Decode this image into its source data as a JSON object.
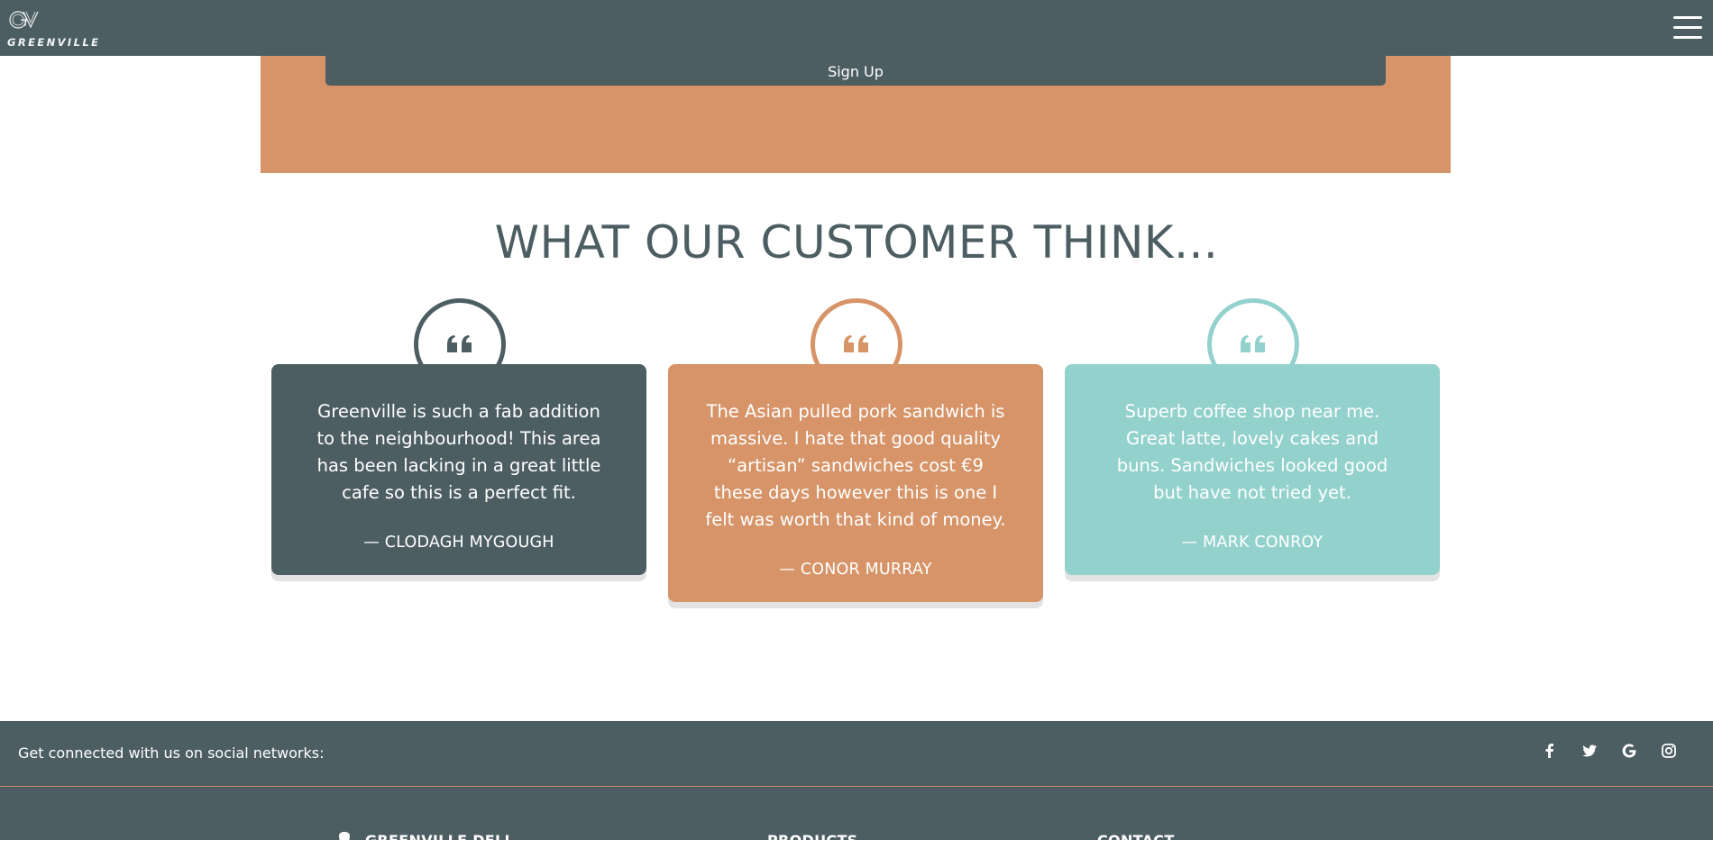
{
  "brand": {
    "name": "GREENVILLE",
    "monogram": "GV"
  },
  "nav": {
    "menu_icon": "hamburger-icon"
  },
  "signup": {
    "button_label": "Sign Up"
  },
  "testimonials": {
    "title": "WHAT OUR CUSTOMER THINK...",
    "items": [
      {
        "quote": "Greenville is such a fab addition to the neighbourhood! This area has been lacking in a great little cafe so this is a perfect fit.",
        "author": "— CLODAGH MYGOUGH",
        "color": "#4d5e63"
      },
      {
        "quote": "The Asian pulled pork sandwich is massive. I hate that good quality “artisan” sandwiches cost €9 these days however this is one I felt was worth that kind of money.",
        "author": "— CONOR MURRAY",
        "color": "#d69468"
      },
      {
        "quote": "Superb coffee shop near me. Great latte, lovely cakes and buns. Sandwiches looked good but have not tried yet.",
        "author": "— MARK CONROY",
        "color": "#93d1cd"
      }
    ]
  },
  "footer": {
    "social_text": "Get connected with us on social networks:",
    "social_icons": [
      "facebook-icon",
      "twitter-icon",
      "google-icon",
      "instagram-icon"
    ],
    "columns": [
      {
        "heading": "GREENVILLE DELI",
        "icon": "cookie-icon"
      },
      {
        "heading": "PRODUCTS"
      },
      {
        "heading": "CONTACT"
      }
    ]
  },
  "colors": {
    "slate": "#4d5e63",
    "terracotta": "#d69468",
    "mint": "#93d1cd"
  }
}
